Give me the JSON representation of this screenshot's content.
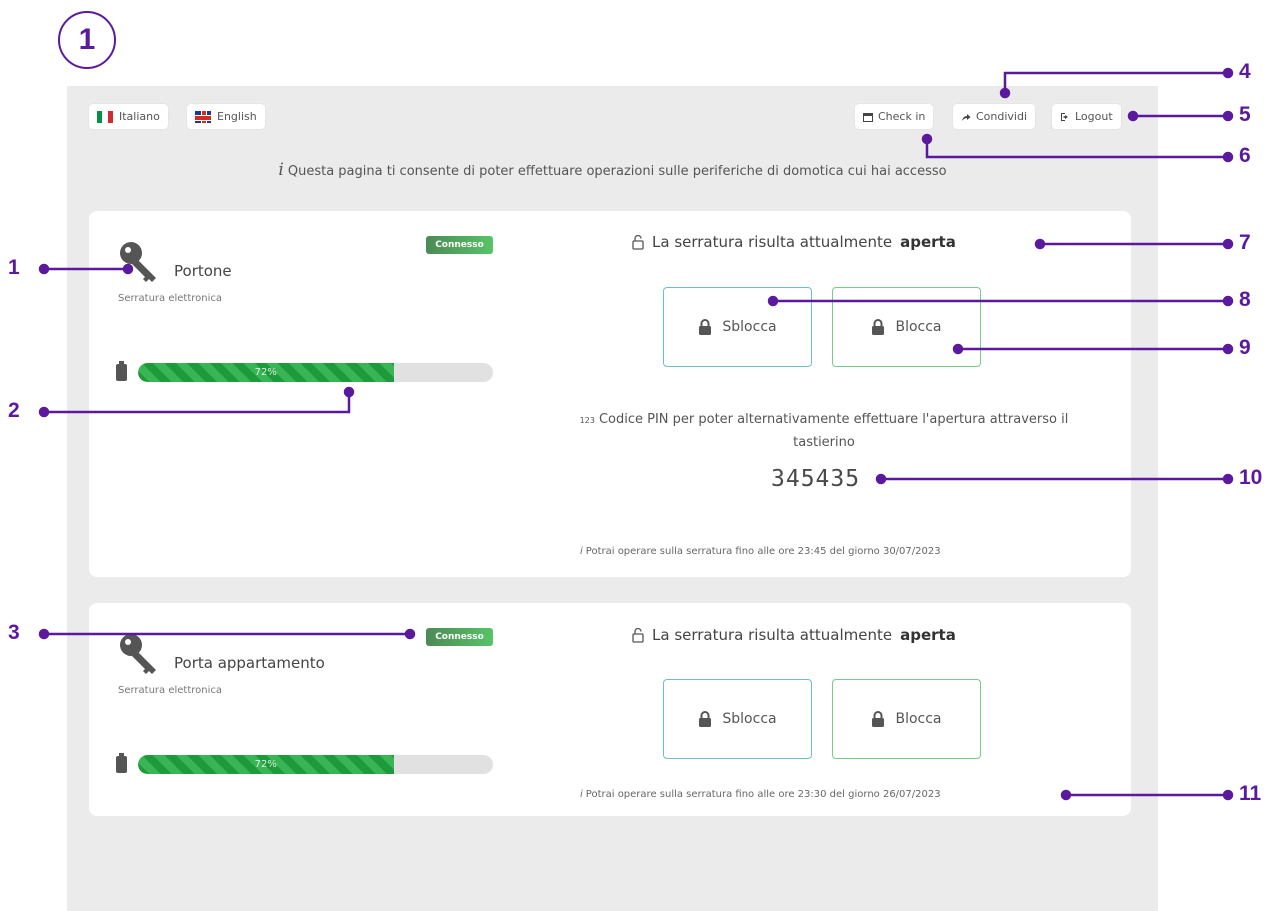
{
  "step_number": "1",
  "languages": [
    {
      "label": "Italiano",
      "flag": "flag-it-icon"
    },
    {
      "label": "English",
      "flag": "flag-uk-icon"
    }
  ],
  "toolbar": {
    "checkin_label": "Check in",
    "share_label": "Condividi",
    "logout_label": "Logout"
  },
  "info_text": "Questa pagina ti consente di poter effettuare operazioni sulle periferiche di domotica cui hai accesso",
  "locks": [
    {
      "name": "Portone",
      "type": "Serratura elettronica",
      "status_badge": "Connesso",
      "battery_percent": 72,
      "battery_label": "72%",
      "status_prefix": "La serratura risulta attualmente",
      "status_value": "aperta",
      "unlock_label": "Sblocca",
      "lock_label": "Blocca",
      "pin_label": "Codice PIN per poter alternativamente effettuare l'apertura attraverso il tastierino",
      "pin_code": "345435",
      "until_text": "Potrai operare sulla serratura fino alle ore 23:45 del giorno 30/07/2023"
    },
    {
      "name": "Porta appartamento",
      "type": "Serratura elettronica",
      "status_badge": "Connesso",
      "battery_percent": 72,
      "battery_label": "72%",
      "status_prefix": "La serratura risulta attualmente",
      "status_value": "aperta",
      "unlock_label": "Sblocca",
      "lock_label": "Blocca",
      "until_text": "Potrai operare sulla serratura fino alle ore 23:30 del giorno 26/07/2023"
    }
  ],
  "callouts": [
    "1",
    "2",
    "3",
    "4",
    "5",
    "6",
    "7",
    "8",
    "9",
    "10",
    "11"
  ],
  "colors": {
    "callout": "#5b1a9e",
    "connected_badge": "#57c467",
    "battery_fill": "#2aa847",
    "unlock_border": "#6dbfc6",
    "lock_border": "#7acb89"
  }
}
